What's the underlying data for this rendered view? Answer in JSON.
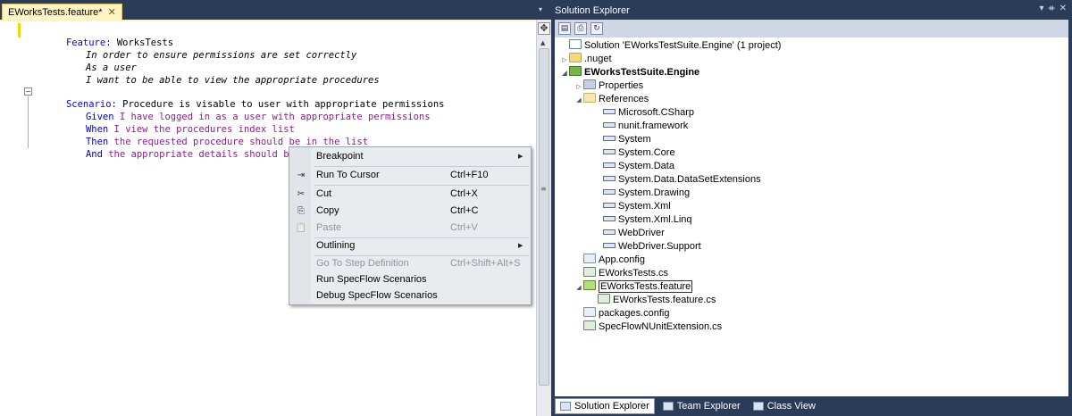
{
  "editor": {
    "tab_title": "EWorksTests.feature*",
    "tab_close": "✕",
    "tab_dropdown": "▾",
    "lines": {
      "feature_kw": "Feature:",
      "feature_name": " WorksTests",
      "desc1": "In order to ensure permissions are set correctly",
      "desc2": "As a user",
      "desc3": "I want to be able to view the appropriate procedures",
      "scenario_kw": "Scenario:",
      "scenario_name": " Procedure is visable to user with appropriate permissions",
      "given_kw": "Given",
      "given_txt": " I have logged in as a user with appropriate permissions",
      "when_kw": "When",
      "when_txt": " I view the procedures index list",
      "then_kw": "Then",
      "then_txt": " the requested procedure should be in the list",
      "and_kw": "And",
      "and_txt": " the appropriate details should be displayed"
    },
    "outline_toggle": "−"
  },
  "scrollbar": {
    "split_icon": "✥",
    "up_icon": "▲",
    "grip_icon": "≡"
  },
  "context_menu": {
    "items": [
      {
        "label": "Breakpoint",
        "shortcut": "",
        "icon": "",
        "submenu": "▶"
      },
      {
        "label": "Run To Cursor",
        "shortcut": "Ctrl+F10",
        "icon": "⇥"
      },
      {
        "label": "Cut",
        "shortcut": "Ctrl+X",
        "icon": "✂"
      },
      {
        "label": "Copy",
        "shortcut": "Ctrl+C",
        "icon": "⎘"
      },
      {
        "label": "Paste",
        "shortcut": "Ctrl+V",
        "icon": "📋"
      },
      {
        "label": "Outlining",
        "shortcut": "",
        "icon": "",
        "submenu": "▶"
      },
      {
        "label": "Go To Step Definition",
        "shortcut": "Ctrl+Shift+Alt+S",
        "icon": ""
      },
      {
        "label": "Run SpecFlow Scenarios",
        "shortcut": "",
        "icon": ""
      },
      {
        "label": "Debug SpecFlow Scenarios",
        "shortcut": "",
        "icon": ""
      }
    ]
  },
  "solution_explorer": {
    "title": "Solution Explorer",
    "title_buttons": [
      "▾",
      "ᚑ",
      "✕"
    ],
    "toolbar_icons": [
      "▤",
      "⎙",
      "↻"
    ],
    "tree": {
      "solution": "Solution 'EWorksTestSuite.Engine' (1 project)",
      "nuget": ".nuget",
      "project": "EWorksTestSuite.Engine",
      "properties": "Properties",
      "references": "References",
      "refs": [
        "Microsoft.CSharp",
        "nunit.framework",
        "System",
        "System.Core",
        "System.Data",
        "System.Data.DataSetExtensions",
        "System.Drawing",
        "System.Xml",
        "System.Xml.Linq",
        "WebDriver",
        "WebDriver.Support"
      ],
      "app_config": "App.config",
      "eworks_tests_cs": "EWorksTests.cs",
      "eworks_feature": "EWorksTests.feature",
      "eworks_feature_cs": "EWorksTests.feature.cs",
      "packages_config": "packages.config",
      "specflow_ext": "SpecFlowNUnitExtension.cs"
    },
    "expanders": {
      "collapsed": "▷",
      "expanded": "◢"
    },
    "bottom_tabs": [
      "Solution Explorer",
      "Team Explorer",
      "Class View"
    ]
  }
}
